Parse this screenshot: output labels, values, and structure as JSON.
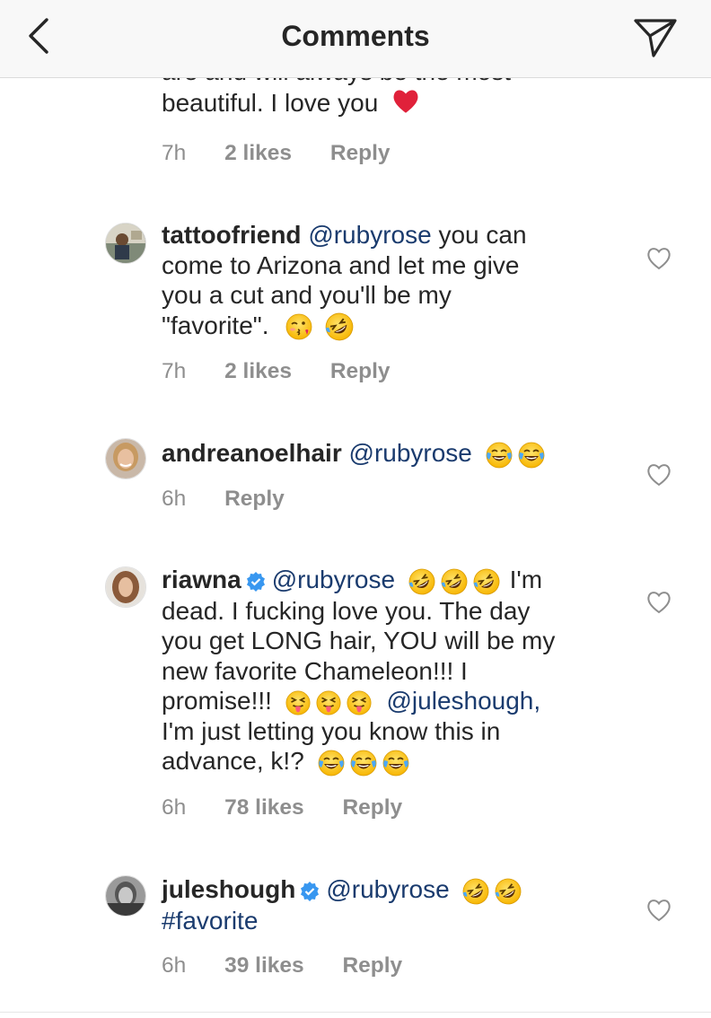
{
  "header": {
    "title": "Comments"
  },
  "comments": [
    {
      "text_line_1": "are and will always be the most",
      "text_line_2": "beautiful. I love you",
      "emoji": "red-heart",
      "time": "7h",
      "likes": "2 likes",
      "reply": "Reply"
    },
    {
      "username": "tattoofriend",
      "mention": "@rubyrose",
      "text_line_1_rest": " you can",
      "text_line_2": "come to Arizona and let me give",
      "text_line_3": "you a cut and you'll be my",
      "text_line_4": "\"favorite\".",
      "emojis": [
        "face-blowing-kiss",
        "rolling-on-floor-laughing"
      ],
      "time": "7h",
      "likes": "2 likes",
      "reply": "Reply"
    },
    {
      "username": "andreanoelhair",
      "mention": "@rubyrose",
      "emojis": [
        "face-with-tears-of-joy",
        "face-with-tears-of-joy"
      ],
      "time": "6h",
      "reply": "Reply"
    },
    {
      "username": "riawna",
      "verified": true,
      "mention": "@rubyrose",
      "text_line_1_rest": "I'm",
      "text_line_2": "dead. I fucking love you. The day",
      "text_line_3": "you get LONG hair, YOU will be my",
      "text_line_4": "new favorite Chameleon!!! I",
      "text_line_5": "promise!!!",
      "mention_2": "@juleshough,",
      "text_line_6": "I'm just letting you know this in",
      "text_line_7": "advance, k!?",
      "emojis": [
        "rolling-on-floor-laughing",
        "squinting-face-with-tongue",
        "face-with-tears-of-joy"
      ],
      "time": "6h",
      "likes": "78 likes",
      "reply": "Reply"
    },
    {
      "username": "juleshough",
      "verified": true,
      "mention": "@rubyrose",
      "hashtag": "#favorite",
      "emojis": [
        "rolling-on-floor-laughing"
      ],
      "time": "6h",
      "likes": "39 likes",
      "reply": "Reply"
    }
  ]
}
